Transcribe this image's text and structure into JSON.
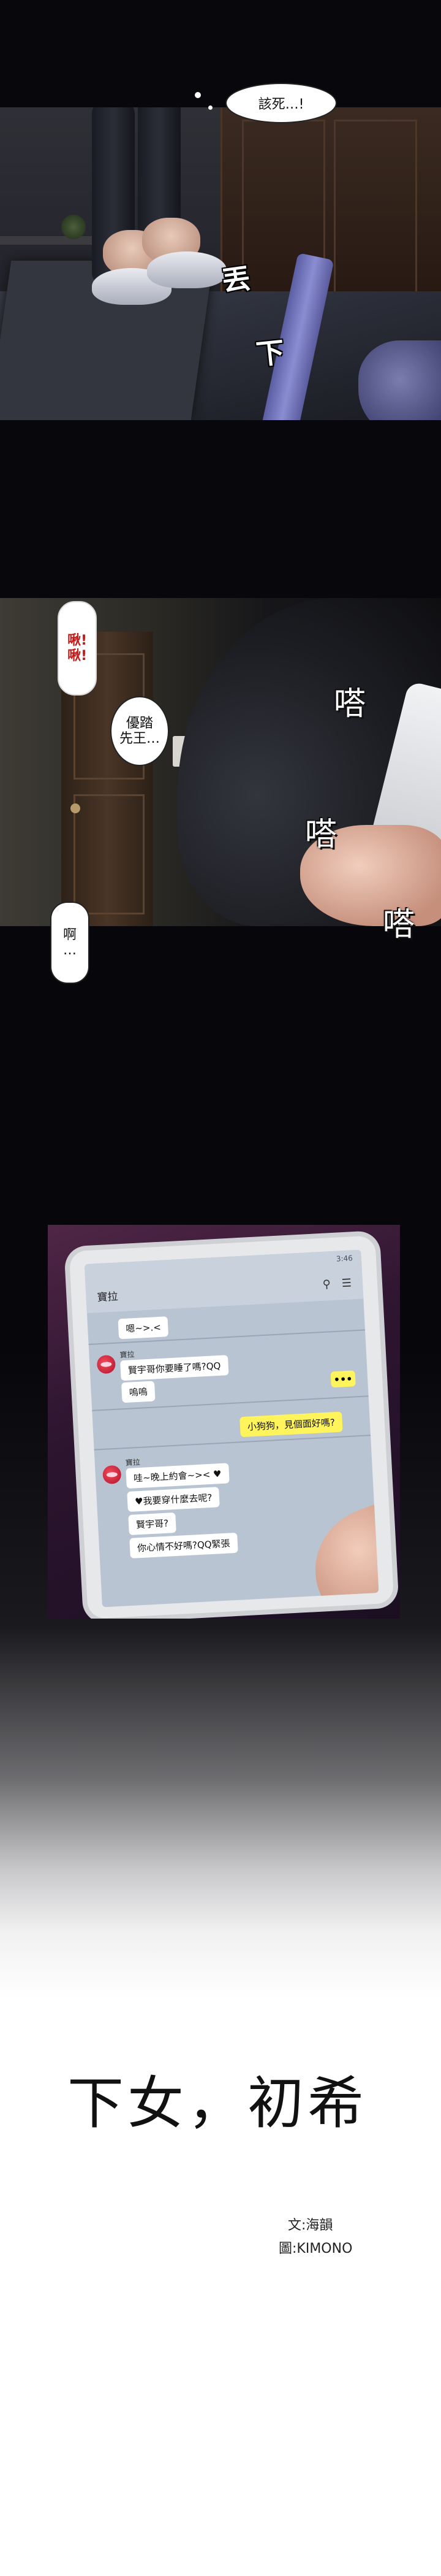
{
  "panel1": {
    "speech": "該死…!",
    "sfx_drop": "丟",
    "sfx_down": "下"
  },
  "panel2": {
    "sfx_jiu": [
      "啾!",
      "啾!"
    ],
    "bubble_ou": [
      "優踏",
      "先王…"
    ],
    "bubble_a": [
      "啊",
      "…"
    ],
    "sfx_ta": [
      "嗒",
      "嗒",
      "嗒"
    ]
  },
  "chat": {
    "status": "3:46",
    "title": "寶拉",
    "header_icons": [
      "search-icon",
      "menu-icon"
    ],
    "messages": [
      {
        "type": "other-plain",
        "text": "嗯~>.<"
      },
      {
        "type": "other",
        "sender": "寶拉",
        "text": "賢宇哥你要睡了嗎?QQ"
      },
      {
        "type": "other-plain",
        "text": "嗚嗚"
      },
      {
        "type": "more",
        "text": "•••"
      },
      {
        "type": "me",
        "text": "小狗狗，見個面好嗎?"
      },
      {
        "type": "other",
        "sender": "寶拉",
        "text": "哇~晚上約會~>< ♥"
      },
      {
        "type": "other-plain",
        "text": "♥我要穿什麼去呢?"
      },
      {
        "type": "other-plain",
        "text": "賢宇哥?"
      },
      {
        "type": "other-plain",
        "text": "你心情不好嗎?QQ緊張"
      }
    ]
  },
  "title": {
    "main": "下女，初希",
    "writer": "文:海韻",
    "artist": "圖:KIMONO"
  }
}
